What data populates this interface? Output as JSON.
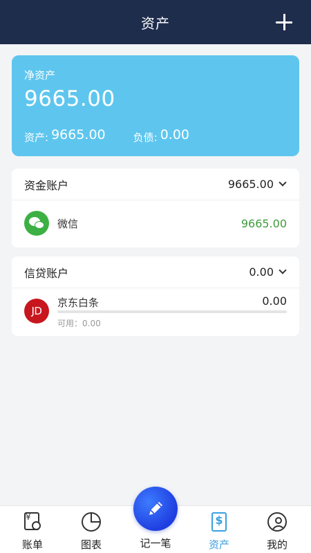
{
  "header": {
    "title": "资产",
    "add_icon": "plus-icon"
  },
  "net_assets": {
    "label": "净资产",
    "value": "9665.00",
    "assets_label": "资产:",
    "assets_value": "9665.00",
    "debt_label": "负债:",
    "debt_value": "0.00",
    "color": "#5ec6ee"
  },
  "fund_accounts": {
    "title": "资金账户",
    "total": "9665.00",
    "items": [
      {
        "name": "微信",
        "amount": "9665.00",
        "icon": "wechat-icon"
      }
    ]
  },
  "credit_accounts": {
    "title": "信贷账户",
    "total": "0.00",
    "items": [
      {
        "name": "京东白条",
        "amount": "0.00",
        "icon_text": "JD",
        "available": "可用：0.00"
      }
    ]
  },
  "tabbar": {
    "tabs": [
      {
        "label": "账单",
        "icon": "bill-icon"
      },
      {
        "label": "图表",
        "icon": "chart-icon"
      },
      {
        "label": "记一笔",
        "icon": "pen-icon"
      },
      {
        "label": "资产",
        "icon": "asset-icon",
        "active": true
      },
      {
        "label": "我的",
        "icon": "profile-icon"
      }
    ],
    "active_color": "#3a9fe0"
  }
}
